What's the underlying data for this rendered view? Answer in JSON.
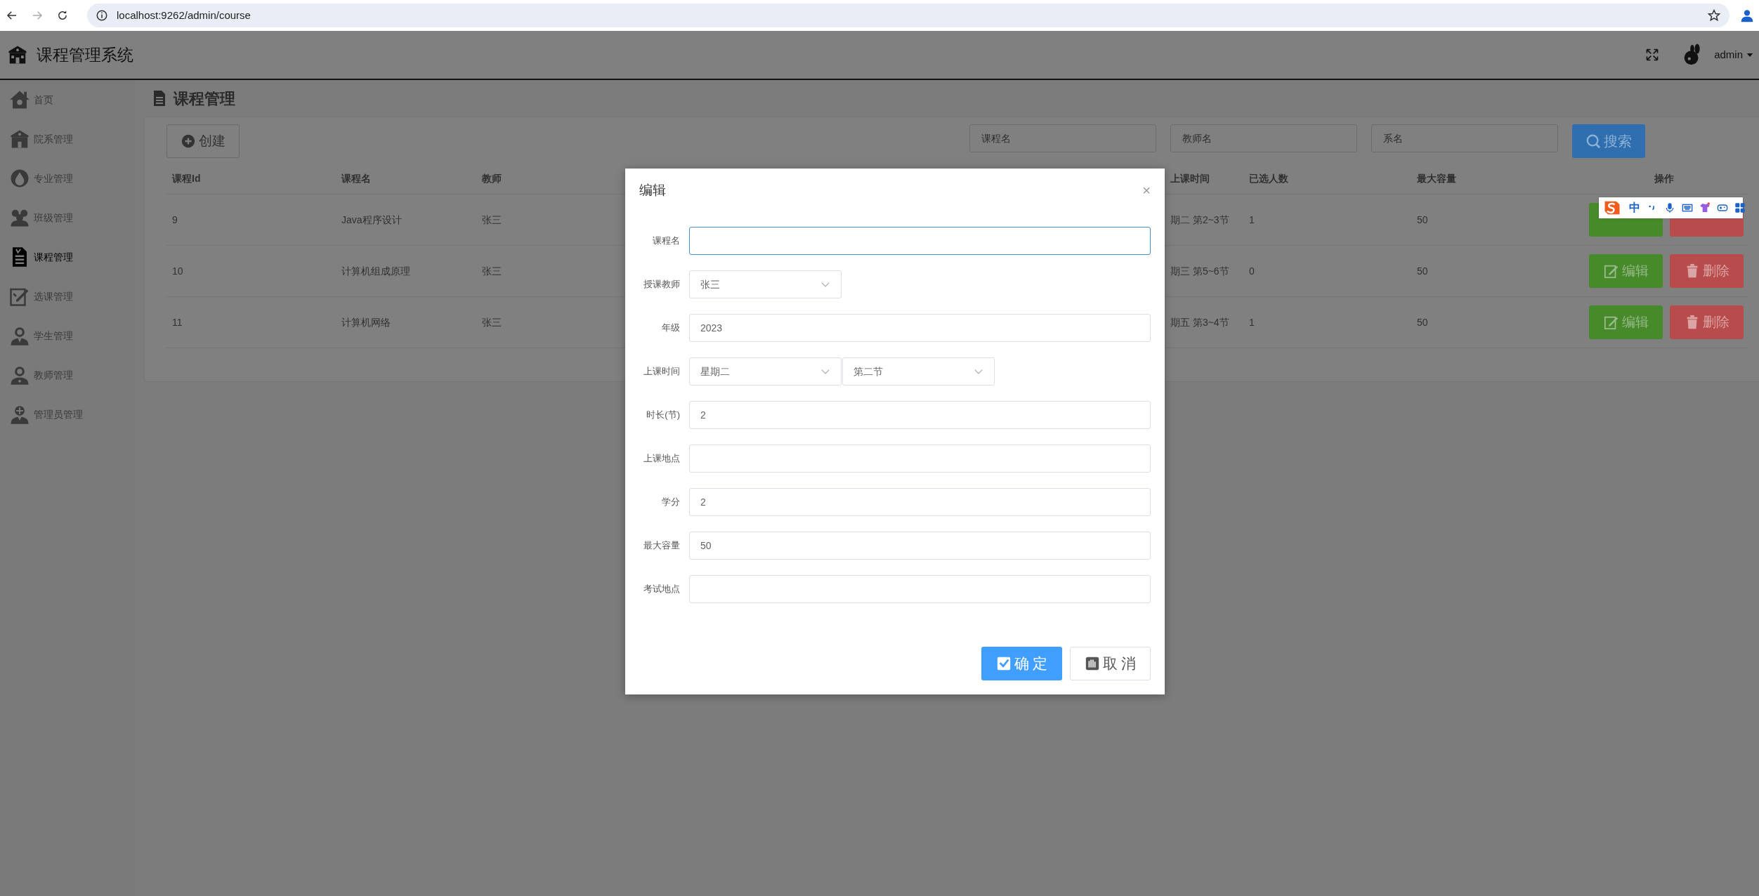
{
  "browser": {
    "url": "localhost:9262/admin/course"
  },
  "app": {
    "title": "课程管理系统",
    "user": "admin"
  },
  "sidebar": {
    "items": [
      {
        "label": "首页",
        "selected": false
      },
      {
        "label": "院系管理",
        "selected": false
      },
      {
        "label": "专业管理",
        "selected": false
      },
      {
        "label": "班级管理",
        "selected": false
      },
      {
        "label": "课程管理",
        "selected": true
      },
      {
        "label": "选课管理",
        "selected": false
      },
      {
        "label": "学生管理",
        "selected": false
      },
      {
        "label": "教师管理",
        "selected": false
      },
      {
        "label": "管理员管理",
        "selected": false
      }
    ]
  },
  "page": {
    "title": "课程管理"
  },
  "toolbar": {
    "create_button": "创建",
    "search_fields": [
      {
        "placeholder": "课程名"
      },
      {
        "placeholder": "教师名"
      },
      {
        "placeholder": "系名"
      }
    ],
    "search_button": "搜索"
  },
  "table": {
    "columns": [
      "课程Id",
      "课程名",
      "教师",
      "上课时间",
      "已选人数",
      "最大容量",
      "操作"
    ],
    "rows": [
      {
        "cells": [
          "9",
          "Java程序设计",
          "张三",
          "期二 第2~3节",
          "1",
          "50"
        ],
        "actions": [
          {
            "kind": "edit"
          },
          {
            "kind": "delete"
          }
        ]
      },
      {
        "cells": [
          "10",
          "计算机组成原理",
          "张三",
          "期三 第5~6节",
          "0",
          "50"
        ],
        "actions": [
          {
            "kind": "edit",
            "label": "编辑"
          },
          {
            "kind": "delete",
            "label": "删除"
          }
        ]
      },
      {
        "cells": [
          "11",
          "计算机网络",
          "张三",
          "期五 第3~4节",
          "1",
          "50"
        ],
        "actions": [
          {
            "kind": "edit",
            "label": "编辑"
          },
          {
            "kind": "delete",
            "label": "删除"
          }
        ]
      }
    ]
  },
  "dialog": {
    "title": "编辑",
    "close": "×",
    "fields": [
      {
        "label": "课程名",
        "kind": "input",
        "focused": true
      },
      {
        "label": "授课教师",
        "kind": "select",
        "values": [
          "张三"
        ],
        "focused": false
      },
      {
        "label": "年级",
        "kind": "input",
        "value": "2023",
        "focused": false
      },
      {
        "label": "上课时间",
        "kind": "select",
        "values": [
          "星期二",
          "第二节"
        ],
        "focused": false
      },
      {
        "label": "时长(节)",
        "kind": "input",
        "value": "2",
        "focused": false
      },
      {
        "label": "上课地点",
        "kind": "input",
        "focused": false
      },
      {
        "label": "学分",
        "kind": "input",
        "value": "2",
        "focused": false
      },
      {
        "label": "最大容量",
        "kind": "input",
        "value": "50",
        "focused": false
      },
      {
        "label": "考试地点",
        "kind": "input",
        "focused": false
      }
    ],
    "buttons": [
      {
        "label": "确 定",
        "kind": "primary"
      },
      {
        "label": "取 消",
        "kind": "default"
      }
    ]
  },
  "ime_toolbar": {
    "label": "中"
  }
}
